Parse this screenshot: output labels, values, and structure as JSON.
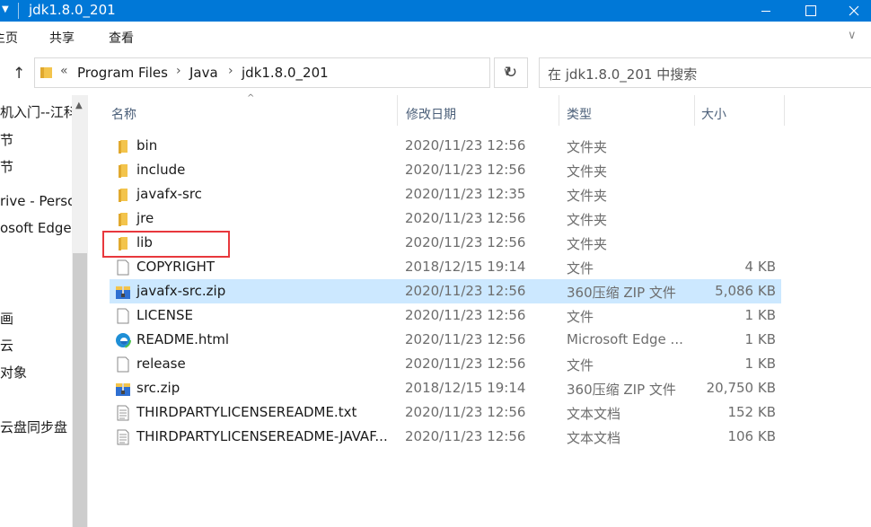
{
  "window": {
    "title": "jdk1.8.0_201"
  },
  "ribbon": {
    "tabs": [
      "主页",
      "共享",
      "查看"
    ]
  },
  "address": {
    "overflow": "«",
    "crumbs": [
      "Program Files",
      "Java",
      "jdk1.8.0_201"
    ]
  },
  "search": {
    "placeholder": "在 jdk1.8.0_201 中搜索"
  },
  "nav": {
    "items": [
      "机入门--江科",
      "节",
      "节",
      "rive - Perso",
      "osoft Edge",
      "画",
      "云",
      "对象",
      "云盘同步盘"
    ]
  },
  "columns": {
    "name": "名称",
    "date": "修改日期",
    "type": "类型",
    "size": "大小"
  },
  "files": [
    {
      "name": "bin",
      "date": "2020/11/23 12:56",
      "type": "文件夹",
      "size": "",
      "icon": "folder-icon"
    },
    {
      "name": "include",
      "date": "2020/11/23 12:56",
      "type": "文件夹",
      "size": "",
      "icon": "folder-icon"
    },
    {
      "name": "javafx-src",
      "date": "2020/11/23 12:35",
      "type": "文件夹",
      "size": "",
      "icon": "folder-icon"
    },
    {
      "name": "jre",
      "date": "2020/11/23 12:56",
      "type": "文件夹",
      "size": "",
      "icon": "folder-icon"
    },
    {
      "name": "lib",
      "date": "2020/11/23 12:56",
      "type": "文件夹",
      "size": "",
      "icon": "folder-icon"
    },
    {
      "name": "COPYRIGHT",
      "date": "2018/12/15 19:14",
      "type": "文件",
      "size": "4 KB",
      "icon": "file-icon"
    },
    {
      "name": "javafx-src.zip",
      "date": "2020/11/23 12:56",
      "type": "360压缩 ZIP 文件",
      "size": "5,086 KB",
      "icon": "zip-archive-icon"
    },
    {
      "name": "LICENSE",
      "date": "2020/11/23 12:56",
      "type": "文件",
      "size": "1 KB",
      "icon": "file-icon"
    },
    {
      "name": "README.html",
      "date": "2020/11/23 12:56",
      "type": "Microsoft Edge ...",
      "size": "1 KB",
      "icon": "edge-icon"
    },
    {
      "name": "release",
      "date": "2020/11/23 12:56",
      "type": "文件",
      "size": "1 KB",
      "icon": "file-icon"
    },
    {
      "name": "src.zip",
      "date": "2018/12/15 19:14",
      "type": "360压缩 ZIP 文件",
      "size": "20,750 KB",
      "icon": "zip-archive-icon"
    },
    {
      "name": "THIRDPARTYLICENSEREADME.txt",
      "date": "2020/11/23 12:56",
      "type": "文本文档",
      "size": "152 KB",
      "icon": "text-file-icon"
    },
    {
      "name": "THIRDPARTYLICENSEREADME-JAVAF...",
      "date": "2020/11/23 12:56",
      "type": "文本文档",
      "size": "106 KB",
      "icon": "text-file-icon"
    }
  ],
  "colors": {
    "titlebar": "#0078d7",
    "selection": "#cce8ff",
    "annotation": "#e8383d",
    "folder": "#f3c44c"
  }
}
